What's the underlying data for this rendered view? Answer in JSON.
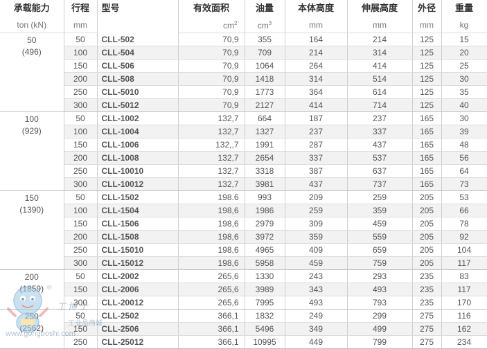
{
  "headers": {
    "capacity": "承载能力",
    "capacity_unit": "ton (kN)",
    "stroke": "行程",
    "stroke_unit": "mm",
    "model": "型号",
    "area": "有效面积",
    "area_unit": "cm",
    "area_exp": "2",
    "oil": "油量",
    "oil_unit": "cm",
    "oil_exp": "3",
    "body_height": "本体高度",
    "body_height_unit": "mm",
    "extended_height": "伸展高度",
    "extended_height_unit": "mm",
    "od": "外径",
    "od_unit": "mm",
    "weight": "重量",
    "weight_unit": "kg"
  },
  "groups": [
    {
      "ton": "50",
      "kn": "(496)",
      "rows": [
        {
          "stroke": "50",
          "model": "CLL-502",
          "area": "70,9",
          "oil": "355",
          "body": "164",
          "ext": "214",
          "od": "125",
          "weight": "15"
        },
        {
          "stroke": "100",
          "model": "CLL-504",
          "area": "70,9",
          "oil": "709",
          "body": "214",
          "ext": "314",
          "od": "125",
          "weight": "20"
        },
        {
          "stroke": "150",
          "model": "CLL-506",
          "area": "70,9",
          "oil": "1064",
          "body": "264",
          "ext": "414",
          "od": "125",
          "weight": "25"
        },
        {
          "stroke": "200",
          "model": "CLL-508",
          "area": "70,9",
          "oil": "1418",
          "body": "314",
          "ext": "514",
          "od": "125",
          "weight": "30"
        },
        {
          "stroke": "250",
          "model": "CLL-5010",
          "area": "70,9",
          "oil": "1773",
          "body": "364",
          "ext": "614",
          "od": "125",
          "weight": "35"
        },
        {
          "stroke": "300",
          "model": "CLL-5012",
          "area": "70,9",
          "oil": "2127",
          "body": "414",
          "ext": "714",
          "od": "125",
          "weight": "40"
        }
      ]
    },
    {
      "ton": "100",
      "kn": "(929)",
      "rows": [
        {
          "stroke": "50",
          "model": "CLL-1002",
          "area": "132,7",
          "oil": "664",
          "body": "187",
          "ext": "237",
          "od": "165",
          "weight": "30"
        },
        {
          "stroke": "100",
          "model": "CLL-1004",
          "area": "132,7",
          "oil": "1327",
          "body": "237",
          "ext": "337",
          "od": "165",
          "weight": "39"
        },
        {
          "stroke": "150",
          "model": "CLL-1006",
          "area": "132,,7",
          "oil": "1991",
          "body": "287",
          "ext": "437",
          "od": "165",
          "weight": "48"
        },
        {
          "stroke": "200",
          "model": "CLL-1008",
          "area": "132,7",
          "oil": "2654",
          "body": "337",
          "ext": "537",
          "od": "165",
          "weight": "56"
        },
        {
          "stroke": "250",
          "model": "CLL-10010",
          "area": "132,7",
          "oil": "3318",
          "body": "387",
          "ext": "637",
          "od": "165",
          "weight": "64"
        },
        {
          "stroke": "300",
          "model": "CLL-10012",
          "area": "132,7",
          "oil": "3981",
          "body": "437",
          "ext": "737",
          "od": "165",
          "weight": "73"
        }
      ]
    },
    {
      "ton": "150",
      "kn": "(1390)",
      "rows": [
        {
          "stroke": "50",
          "model": "CLL-1502",
          "area": "198.6",
          "oil": "993",
          "body": "209",
          "ext": "259",
          "od": "205",
          "weight": "53"
        },
        {
          "stroke": "100",
          "model": "CLL-1504",
          "area": "198,6",
          "oil": "1986",
          "body": "259",
          "ext": "359",
          "od": "205",
          "weight": "66"
        },
        {
          "stroke": "150",
          "model": "CLL-1506",
          "area": "198,6",
          "oil": "2979",
          "body": "309",
          "ext": "459",
          "od": "205",
          "weight": "78"
        },
        {
          "stroke": "200",
          "model": "CLL-1508",
          "area": "198,6",
          "oil": "3972",
          "body": "359",
          "ext": "559",
          "od": "205",
          "weight": "92"
        },
        {
          "stroke": "250",
          "model": "CLL-15010",
          "area": "198,6",
          "oil": "4965",
          "body": "409",
          "ext": "659",
          "od": "205",
          "weight": "104"
        },
        {
          "stroke": "300",
          "model": "CLL-15012",
          "area": "198,6",
          "oil": "5958",
          "body": "459",
          "ext": "759",
          "od": "205",
          "weight": "117"
        }
      ]
    },
    {
      "ton": "200",
      "kn": "(1859)",
      "rows": [
        {
          "stroke": "50",
          "model": "CLL-2002",
          "area": "265,6",
          "oil": "1330",
          "body": "243",
          "ext": "293",
          "od": "235",
          "weight": "83"
        },
        {
          "stroke": "150",
          "model": "CLL-2006",
          "area": "265,6",
          "oil": "3989",
          "body": "343",
          "ext": "493",
          "od": "235",
          "weight": "117"
        },
        {
          "stroke": "300",
          "model": "CLL-20012",
          "area": "265,6",
          "oil": "7995",
          "body": "493",
          "ext": "793",
          "od": "235",
          "weight": "170"
        }
      ]
    },
    {
      "ton": "250",
      "kn": "(2562)",
      "rows": [
        {
          "stroke": "50",
          "model": "CLL-2502",
          "area": "366,1",
          "oil": "1832",
          "body": "249",
          "ext": "299",
          "od": "275",
          "weight": "116"
        },
        {
          "stroke": "150",
          "model": "CLL-2506",
          "area": "366,1",
          "oil": "5496",
          "body": "349",
          "ext": "499",
          "od": "275",
          "weight": "162"
        },
        {
          "stroke": "250",
          "model": "CLL-25012",
          "area": "366,1",
          "oil": "10995",
          "body": "449",
          "ext": "799",
          "od": "275",
          "weight": "234"
        }
      ]
    }
  ],
  "watermark": {
    "brand": "工博士",
    "tagline": "工业品商城",
    "url": "www.gongboshi.com",
    "reg": "®"
  }
}
